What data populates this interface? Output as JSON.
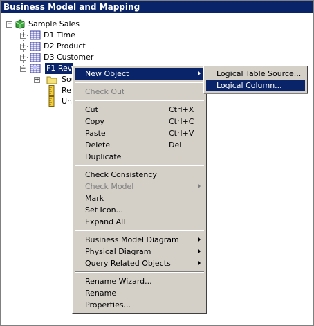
{
  "panel": {
    "title": "Business Model and Mapping"
  },
  "tree": {
    "root": {
      "label": "Sample Sales",
      "expander": "−"
    },
    "nodes": [
      {
        "label": "D1 Time",
        "expander": "+"
      },
      {
        "label": "D2 Product",
        "expander": "+"
      },
      {
        "label": "D3 Customer",
        "expander": "+"
      },
      {
        "label": "F1 Rev",
        "expander": "−"
      }
    ],
    "children": [
      {
        "label": "Sou",
        "expander": "+"
      },
      {
        "label": "Re"
      },
      {
        "label": "Un"
      }
    ]
  },
  "context_menu": {
    "items": [
      {
        "label": "New Object",
        "shortcut": "",
        "submenu": true,
        "state": "highlighted"
      },
      {
        "label": "Check Out",
        "shortcut": "",
        "submenu": false,
        "state": "disabled"
      },
      {
        "label": "Cut",
        "shortcut": "Ctrl+X",
        "submenu": false,
        "state": "enabled"
      },
      {
        "label": "Copy",
        "shortcut": "Ctrl+C",
        "submenu": false,
        "state": "enabled"
      },
      {
        "label": "Paste",
        "shortcut": "Ctrl+V",
        "submenu": false,
        "state": "enabled"
      },
      {
        "label": "Delete",
        "shortcut": "Del",
        "submenu": false,
        "state": "enabled"
      },
      {
        "label": "Duplicate",
        "shortcut": "",
        "submenu": false,
        "state": "enabled"
      },
      {
        "label": "Check Consistency",
        "shortcut": "",
        "submenu": false,
        "state": "enabled"
      },
      {
        "label": "Check Model",
        "shortcut": "",
        "submenu": true,
        "state": "disabled"
      },
      {
        "label": "Mark",
        "shortcut": "",
        "submenu": false,
        "state": "enabled"
      },
      {
        "label": "Set Icon...",
        "shortcut": "",
        "submenu": false,
        "state": "enabled"
      },
      {
        "label": "Expand All",
        "shortcut": "",
        "submenu": false,
        "state": "enabled"
      },
      {
        "label": "Business Model Diagram",
        "shortcut": "",
        "submenu": true,
        "state": "enabled"
      },
      {
        "label": "Physical Diagram",
        "shortcut": "",
        "submenu": true,
        "state": "enabled"
      },
      {
        "label": "Query Related Objects",
        "shortcut": "",
        "submenu": true,
        "state": "enabled"
      },
      {
        "label": "Rename Wizard...",
        "shortcut": "",
        "submenu": false,
        "state": "enabled"
      },
      {
        "label": "Rename",
        "shortcut": "",
        "submenu": false,
        "state": "enabled"
      },
      {
        "label": "Properties...",
        "shortcut": "",
        "submenu": false,
        "state": "enabled"
      }
    ]
  },
  "submenu": {
    "items": [
      {
        "label": "Logical Table Source...",
        "state": "enabled"
      },
      {
        "label": "Logical Column...",
        "state": "highlighted"
      }
    ]
  },
  "colors": {
    "selection": "#0a246a",
    "menu_bg": "#d4d0c8",
    "disabled_text": "#808080"
  }
}
